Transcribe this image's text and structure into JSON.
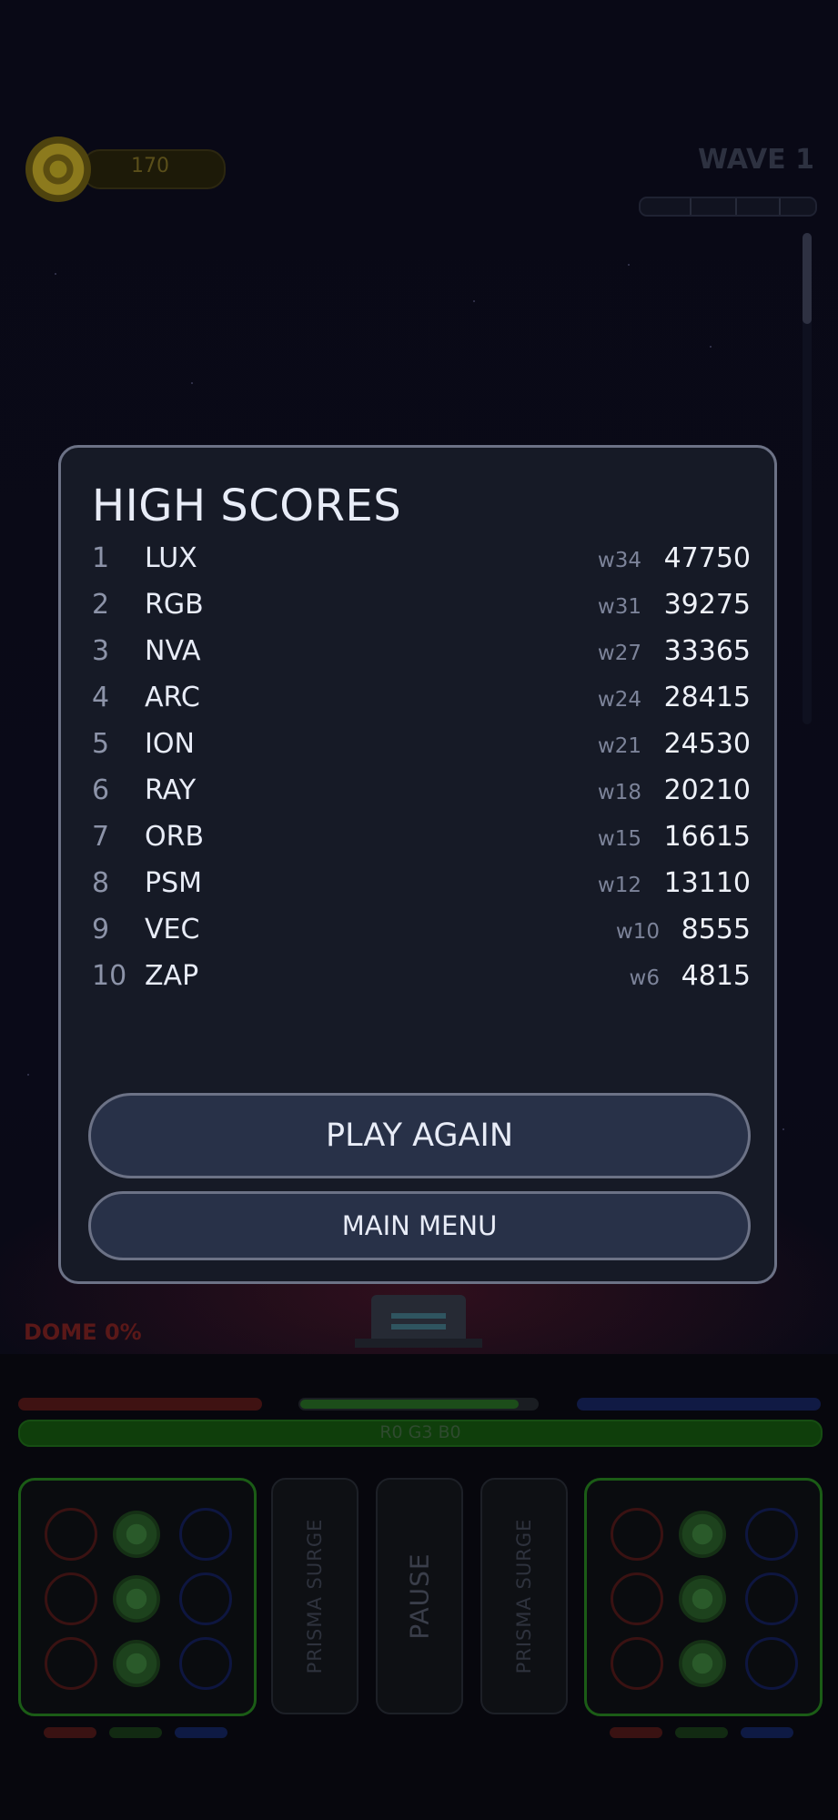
{
  "hud": {
    "coins": "170",
    "wave_label": "WAVE 1",
    "dome_label": "DOME 0%",
    "rgb_readout": "R0  G3  B0",
    "colors": {
      "red": "#3f1212",
      "green": "#1c4d1a",
      "blue": "#101a44"
    }
  },
  "controls": {
    "left_surge": "PRISMA SURGE",
    "pause": "PAUSE",
    "right_surge": "PRISMA SURGE"
  },
  "high_scores": {
    "title": "HIGH SCORES",
    "entries": [
      {
        "rank": "1",
        "name": "LUX",
        "wave": "w34",
        "score": "47750"
      },
      {
        "rank": "2",
        "name": "RGB",
        "wave": "w31",
        "score": "39275"
      },
      {
        "rank": "3",
        "name": "NVA",
        "wave": "w27",
        "score": "33365"
      },
      {
        "rank": "4",
        "name": "ARC",
        "wave": "w24",
        "score": "28415"
      },
      {
        "rank": "5",
        "name": "ION",
        "wave": "w21",
        "score": "24530"
      },
      {
        "rank": "6",
        "name": "RAY",
        "wave": "w18",
        "score": "20210"
      },
      {
        "rank": "7",
        "name": "ORB",
        "wave": "w15",
        "score": "16615"
      },
      {
        "rank": "8",
        "name": "PSM",
        "wave": "w12",
        "score": "13110"
      },
      {
        "rank": "9",
        "name": "VEC",
        "wave": "w10",
        "score": "8555"
      },
      {
        "rank": "10",
        "name": "ZAP",
        "wave": "w6",
        "score": "4815"
      }
    ],
    "play_again_label": "PLAY AGAIN",
    "main_menu_label": "MAIN MENU"
  }
}
